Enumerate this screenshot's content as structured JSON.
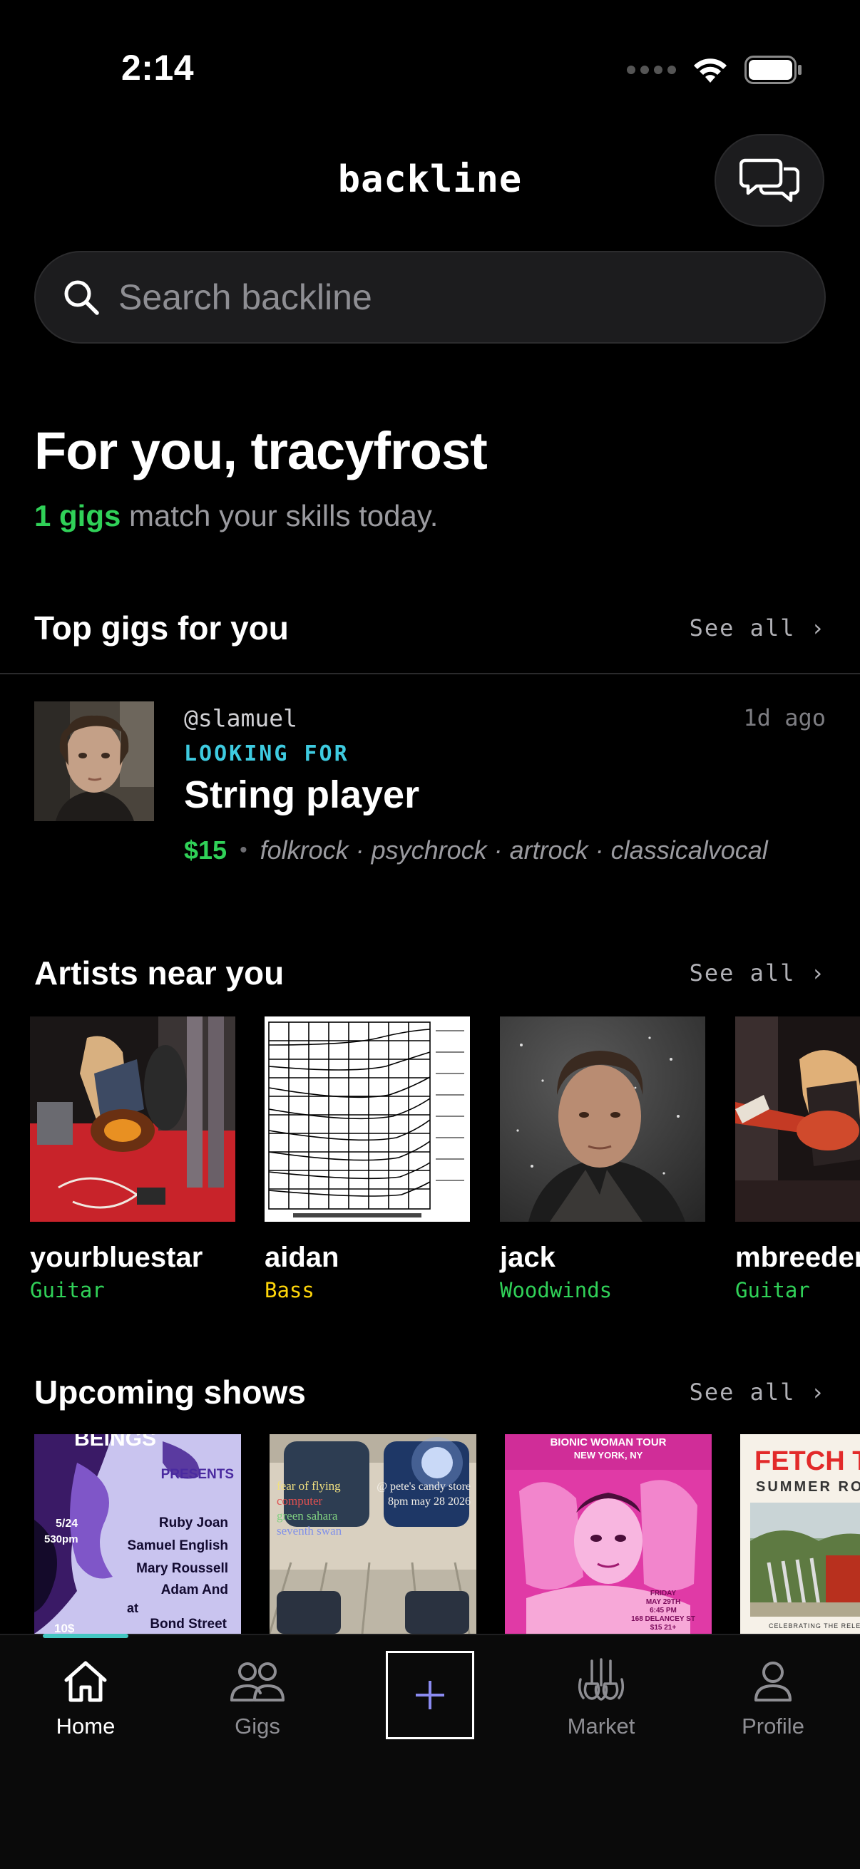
{
  "status_bar": {
    "time": "2:14"
  },
  "header": {
    "title": "backline"
  },
  "search": {
    "placeholder": "Search backline"
  },
  "greeting": {
    "title": "For you, tracyfrost",
    "highlight": "1 gigs",
    "rest": " match your skills today."
  },
  "sections": {
    "top_gigs": {
      "title": "Top gigs for you",
      "see_all": "See all ›"
    },
    "artists": {
      "title": "Artists near you",
      "see_all": "See all ›"
    },
    "shows": {
      "title": "Upcoming shows",
      "see_all": "See all ›"
    }
  },
  "gig": {
    "user": "@slamuel",
    "time": "1d ago",
    "looking_for": "LOOKING FOR",
    "role": "String player",
    "price": "$15",
    "genres": "folkrock · psychrock · artrock · classicalvocal"
  },
  "artists": [
    {
      "name": "yourbluestar",
      "instrument": "Guitar",
      "color": "#30d158"
    },
    {
      "name": "aidan",
      "instrument": "Bass",
      "color": "#ffd60a"
    },
    {
      "name": "jack",
      "instrument": "Woodwinds",
      "color": "#30d158"
    },
    {
      "name": "mbreeder",
      "instrument": "Guitar",
      "color": "#30d158"
    }
  ],
  "shows": [
    {
      "title": "BEINGS",
      "presents": "PRESENTS",
      "date": "5/24",
      "time": "530pm",
      "lineup": [
        "Ruby Joan",
        "Samuel English",
        "Mary Roussell",
        "Adam And"
      ],
      "at": "at",
      "venue": "Bond Street",
      "price": "10$"
    },
    {
      "lines": [
        "fear of flying",
        "computer",
        "green sahara",
        "seventh swan"
      ],
      "venue": "@ pete's candy store",
      "date": "8pm may 28 2026"
    },
    {
      "title": "BIONIC WOMAN TOUR",
      "city": "NEW YORK, NY",
      "details": [
        "FRIDAY",
        "MAY 29TH",
        "6:45 PM",
        "168 DELANCEY ST",
        "$15   21+"
      ]
    },
    {
      "title": "FETCH T",
      "subtitle": "SUMMER ROC",
      "caption": "CELEBRATING THE RELEASE OF"
    }
  ],
  "tabs": [
    {
      "label": "Home",
      "icon": "home-icon",
      "active": true
    },
    {
      "label": "Gigs",
      "icon": "people-icon",
      "active": false
    },
    {
      "label": "Market",
      "icon": "guitars-icon",
      "active": false
    },
    {
      "label": "Profile",
      "icon": "person-icon",
      "active": false
    }
  ],
  "colors": {
    "accent_green": "#30d158",
    "accent_cyan": "#3ecbe0",
    "accent_yellow": "#ffd60a",
    "tab_indicator": "#44c7c2"
  }
}
